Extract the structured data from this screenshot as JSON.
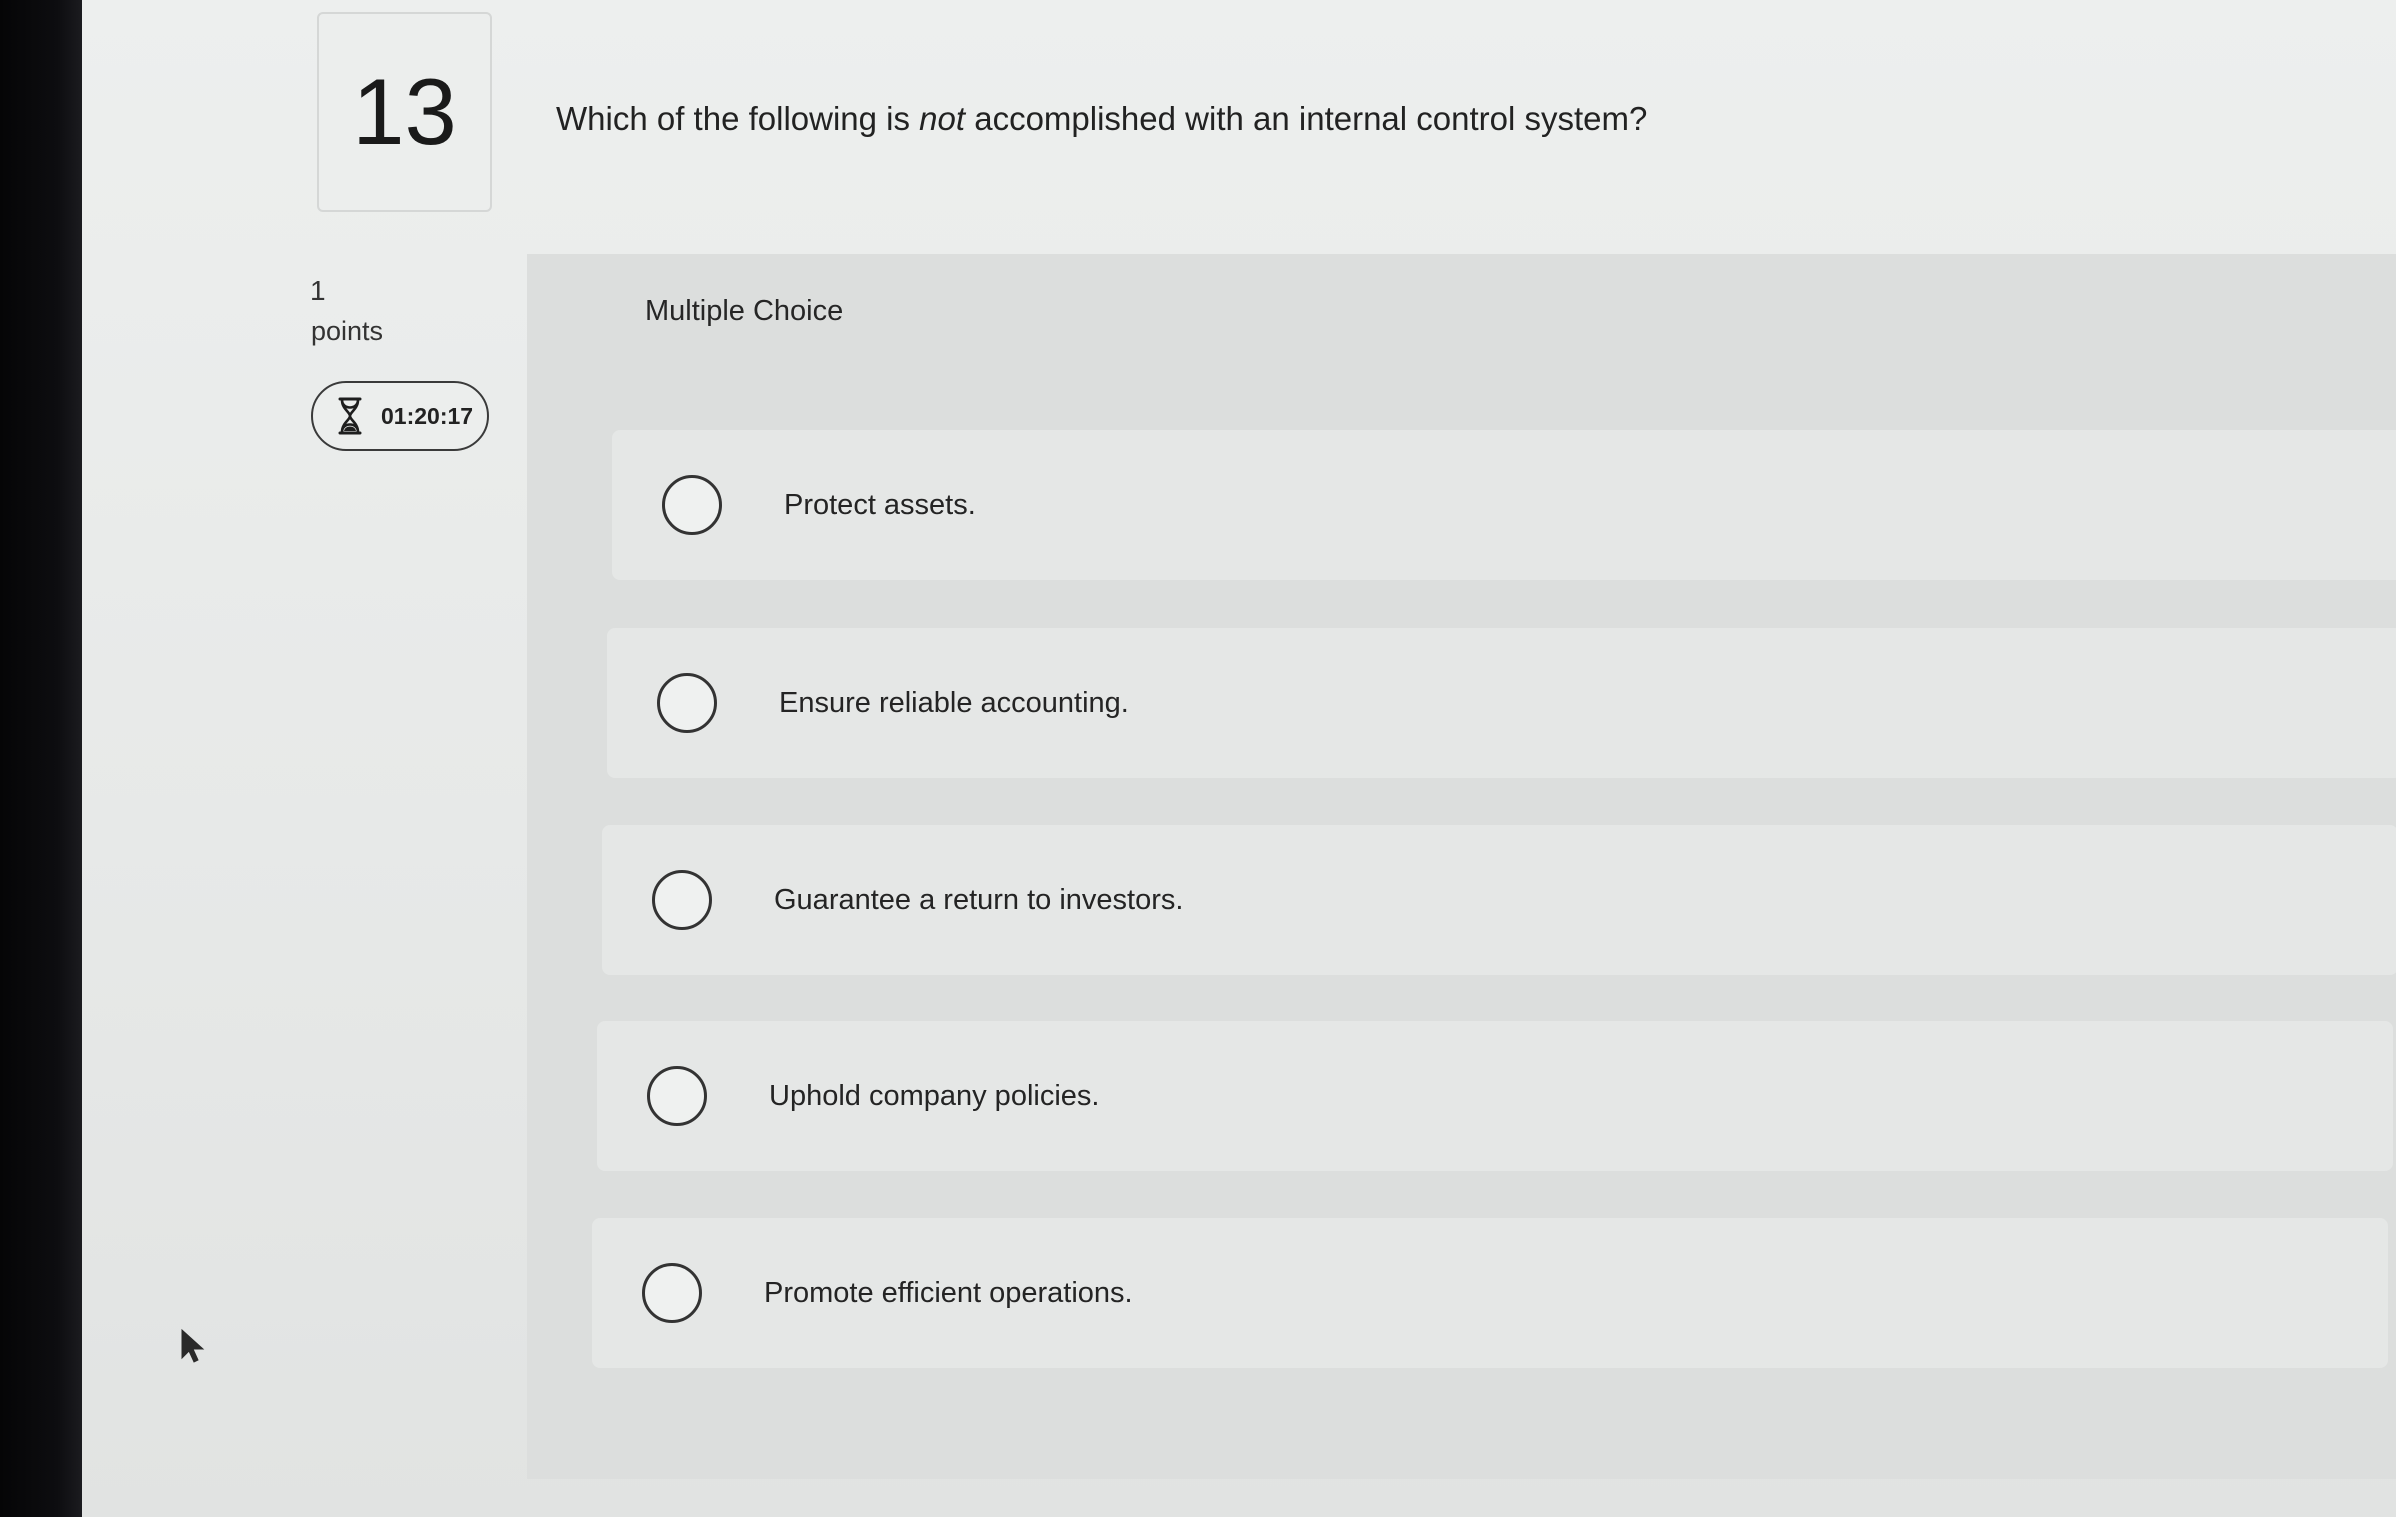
{
  "question": {
    "number": "13",
    "text_before": "Which of the following is ",
    "text_emphasis": "not",
    "text_after": " accomplished with an internal control system?",
    "points_value": "1",
    "points_label": "points",
    "timer": "01:20:17",
    "timer_icon": "hourglass-icon"
  },
  "answer": {
    "type_label": "Multiple Choice",
    "options": [
      {
        "label": "Protect assets."
      },
      {
        "label": "Ensure reliable accounting."
      },
      {
        "label": "Guarantee a return to investors."
      },
      {
        "label": "Uphold company policies."
      },
      {
        "label": "Promote efficient operations."
      }
    ]
  }
}
